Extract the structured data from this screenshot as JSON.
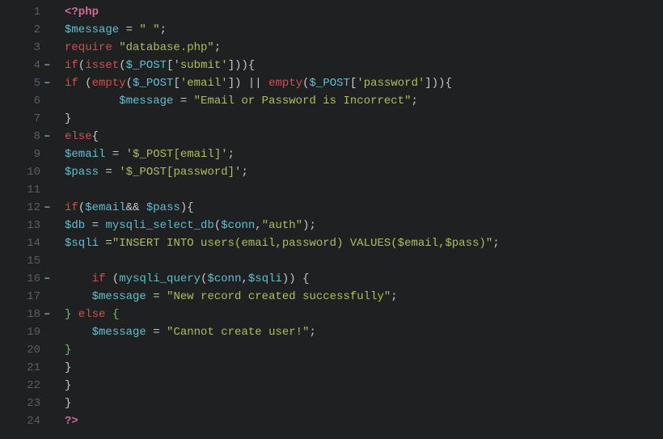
{
  "lines": [
    {
      "n": 1,
      "fold": false,
      "tokens": [
        {
          "cls": "t-php",
          "t": "<?php"
        }
      ]
    },
    {
      "n": 2,
      "fold": false,
      "tokens": [
        {
          "cls": "t-var",
          "t": "$message"
        },
        {
          "cls": "t-plain",
          "t": " = "
        },
        {
          "cls": "t-str",
          "t": "\" \""
        },
        {
          "cls": "t-plain",
          "t": ";"
        }
      ]
    },
    {
      "n": 3,
      "fold": false,
      "tokens": [
        {
          "cls": "t-kw",
          "t": "require"
        },
        {
          "cls": "t-plain",
          "t": " "
        },
        {
          "cls": "t-str",
          "t": "\"database.php\""
        },
        {
          "cls": "t-plain",
          "t": ";"
        }
      ]
    },
    {
      "n": 4,
      "fold": true,
      "tokens": [
        {
          "cls": "t-kw",
          "t": "if"
        },
        {
          "cls": "t-plain",
          "t": "("
        },
        {
          "cls": "t-kw",
          "t": "isset"
        },
        {
          "cls": "t-plain",
          "t": "("
        },
        {
          "cls": "t-var",
          "t": "$_POST"
        },
        {
          "cls": "t-plain",
          "t": "["
        },
        {
          "cls": "t-str",
          "t": "'submit'"
        },
        {
          "cls": "t-plain",
          "t": "])){"
        }
      ]
    },
    {
      "n": 5,
      "fold": true,
      "tokens": [
        {
          "cls": "t-kw",
          "t": "if"
        },
        {
          "cls": "t-plain",
          "t": " ("
        },
        {
          "cls": "t-kw",
          "t": "empty"
        },
        {
          "cls": "t-plain",
          "t": "("
        },
        {
          "cls": "t-var",
          "t": "$_POST"
        },
        {
          "cls": "t-plain",
          "t": "["
        },
        {
          "cls": "t-str",
          "t": "'email'"
        },
        {
          "cls": "t-plain",
          "t": "]) || "
        },
        {
          "cls": "t-kw",
          "t": "empty"
        },
        {
          "cls": "t-plain",
          "t": "("
        },
        {
          "cls": "t-var",
          "t": "$_POST"
        },
        {
          "cls": "t-plain",
          "t": "["
        },
        {
          "cls": "t-str",
          "t": "'password'"
        },
        {
          "cls": "t-plain",
          "t": "])){"
        }
      ]
    },
    {
      "n": 6,
      "fold": false,
      "tokens": [
        {
          "cls": "t-plain",
          "t": "        "
        },
        {
          "cls": "t-var",
          "t": "$message"
        },
        {
          "cls": "t-plain",
          "t": " = "
        },
        {
          "cls": "t-str",
          "t": "\"Email or Password is Incorrect\""
        },
        {
          "cls": "t-plain",
          "t": ";"
        }
      ]
    },
    {
      "n": 7,
      "fold": false,
      "tokens": [
        {
          "cls": "t-plain",
          "t": "}"
        }
      ]
    },
    {
      "n": 8,
      "fold": true,
      "tokens": [
        {
          "cls": "t-kw",
          "t": "else"
        },
        {
          "cls": "t-plain",
          "t": "{"
        }
      ]
    },
    {
      "n": 9,
      "fold": false,
      "tokens": [
        {
          "cls": "t-var",
          "t": "$email"
        },
        {
          "cls": "t-plain",
          "t": " = "
        },
        {
          "cls": "t-str",
          "t": "'$_POST[email]'"
        },
        {
          "cls": "t-plain",
          "t": ";"
        }
      ]
    },
    {
      "n": 10,
      "fold": false,
      "tokens": [
        {
          "cls": "t-var",
          "t": "$pass"
        },
        {
          "cls": "t-plain",
          "t": " = "
        },
        {
          "cls": "t-str",
          "t": "'$_POST[password]'"
        },
        {
          "cls": "t-plain",
          "t": ";"
        }
      ]
    },
    {
      "n": 11,
      "fold": false,
      "tokens": []
    },
    {
      "n": 12,
      "fold": true,
      "tokens": [
        {
          "cls": "t-kw",
          "t": "if"
        },
        {
          "cls": "t-plain",
          "t": "("
        },
        {
          "cls": "t-var",
          "t": "$email"
        },
        {
          "cls": "t-plain",
          "t": "&& "
        },
        {
          "cls": "t-var",
          "t": "$pass"
        },
        {
          "cls": "t-plain",
          "t": "){"
        }
      ]
    },
    {
      "n": 13,
      "fold": false,
      "tokens": [
        {
          "cls": "t-var",
          "t": "$db"
        },
        {
          "cls": "t-plain",
          "t": " = "
        },
        {
          "cls": "t-fn",
          "t": "mysqli_select_db"
        },
        {
          "cls": "t-plain",
          "t": "("
        },
        {
          "cls": "t-var",
          "t": "$conn"
        },
        {
          "cls": "t-plain",
          "t": ","
        },
        {
          "cls": "t-str",
          "t": "\"auth\""
        },
        {
          "cls": "t-plain",
          "t": ");"
        }
      ]
    },
    {
      "n": 14,
      "fold": false,
      "tokens": [
        {
          "cls": "t-var",
          "t": "$sqli"
        },
        {
          "cls": "t-plain",
          "t": " ="
        },
        {
          "cls": "t-str",
          "t": "\"INSERT INTO users(email,password) VALUES($email,$pass)\""
        },
        {
          "cls": "t-plain",
          "t": ";"
        }
      ]
    },
    {
      "n": 15,
      "fold": false,
      "tokens": []
    },
    {
      "n": 16,
      "fold": true,
      "tokens": [
        {
          "cls": "t-plain",
          "t": "    "
        },
        {
          "cls": "t-kw",
          "t": "if"
        },
        {
          "cls": "t-plain",
          "t": " ("
        },
        {
          "cls": "t-fn",
          "t": "mysqli_query"
        },
        {
          "cls": "t-plain",
          "t": "("
        },
        {
          "cls": "t-var",
          "t": "$conn"
        },
        {
          "cls": "t-plain",
          "t": ","
        },
        {
          "cls": "t-var",
          "t": "$sqli"
        },
        {
          "cls": "t-plain",
          "t": ")) {"
        }
      ]
    },
    {
      "n": 17,
      "fold": false,
      "tokens": [
        {
          "cls": "t-plain",
          "t": "    "
        },
        {
          "cls": "t-var",
          "t": "$message"
        },
        {
          "cls": "t-plain",
          "t": " = "
        },
        {
          "cls": "t-str",
          "t": "\"New record created successfully\""
        },
        {
          "cls": "t-plain",
          "t": ";"
        }
      ]
    },
    {
      "n": 18,
      "fold": true,
      "tokens": [
        {
          "cls": "t-brace-g",
          "t": "}"
        },
        {
          "cls": "t-plain",
          "t": " "
        },
        {
          "cls": "t-kw",
          "t": "else"
        },
        {
          "cls": "t-plain",
          "t": " "
        },
        {
          "cls": "t-brace-g",
          "t": "{"
        }
      ]
    },
    {
      "n": 19,
      "fold": false,
      "tokens": [
        {
          "cls": "t-plain",
          "t": "    "
        },
        {
          "cls": "t-var",
          "t": "$message"
        },
        {
          "cls": "t-plain",
          "t": " = "
        },
        {
          "cls": "t-str",
          "t": "\"Cannot create user!\""
        },
        {
          "cls": "t-plain",
          "t": ";"
        }
      ]
    },
    {
      "n": 20,
      "fold": false,
      "tokens": [
        {
          "cls": "t-brace-g",
          "t": "}"
        }
      ]
    },
    {
      "n": 21,
      "fold": false,
      "tokens": [
        {
          "cls": "t-plain",
          "t": "}"
        }
      ]
    },
    {
      "n": 22,
      "fold": false,
      "tokens": [
        {
          "cls": "t-plain",
          "t": "}"
        }
      ]
    },
    {
      "n": 23,
      "fold": false,
      "tokens": [
        {
          "cls": "t-plain",
          "t": "}"
        }
      ]
    },
    {
      "n": 24,
      "fold": false,
      "tokens": [
        {
          "cls": "t-php",
          "t": "?>"
        }
      ]
    }
  ]
}
